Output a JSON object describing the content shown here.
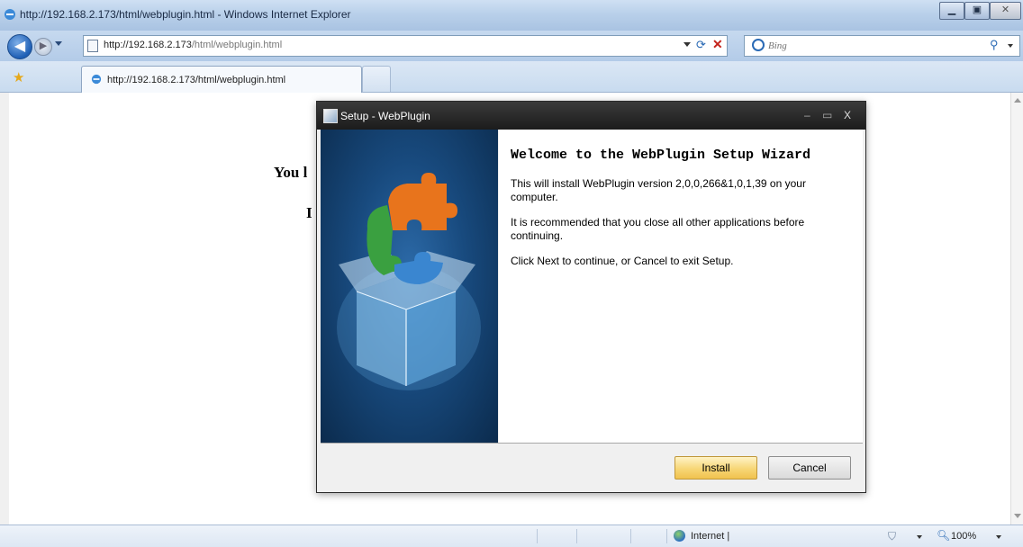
{
  "browser": {
    "window_title": "http://192.168.2.173/html/webplugin.html - Windows Internet Explorer",
    "address": {
      "url_host": "http://192.168.2.173",
      "url_path": "/html/webplugin.html"
    },
    "search": {
      "placeholder": "Bing"
    },
    "tab": {
      "label": "http://192.168.2.173/html/webplugin.html"
    },
    "status": {
      "zone": "Internet |",
      "zoom": "100%"
    }
  },
  "page": {
    "text1": "You l",
    "text2": "I",
    "text3": "("
  },
  "dialog": {
    "title": "Setup - WebPlugin",
    "heading": "Welcome to the WebPlugin Setup Wizard",
    "paragraphs": [
      "This will install WebPlugin version 2,0,0,266&1,0,1,39 on your computer.",
      "It is recommended that you close all other applications before continuing.",
      "Click Next to continue, or Cancel to exit Setup."
    ],
    "buttons": {
      "install": "Install",
      "cancel": "Cancel"
    },
    "controls": {
      "minimize": "–",
      "maximize": "▭",
      "close": "X"
    }
  },
  "colors": {
    "dialog_titlebar": "#1c1c1c",
    "side_panel": "#184a7e",
    "install_button": "#f7d676",
    "puzzle_orange": "#e8741c",
    "puzzle_green": "#3aa040",
    "puzzle_blue": "#3a86d0"
  }
}
